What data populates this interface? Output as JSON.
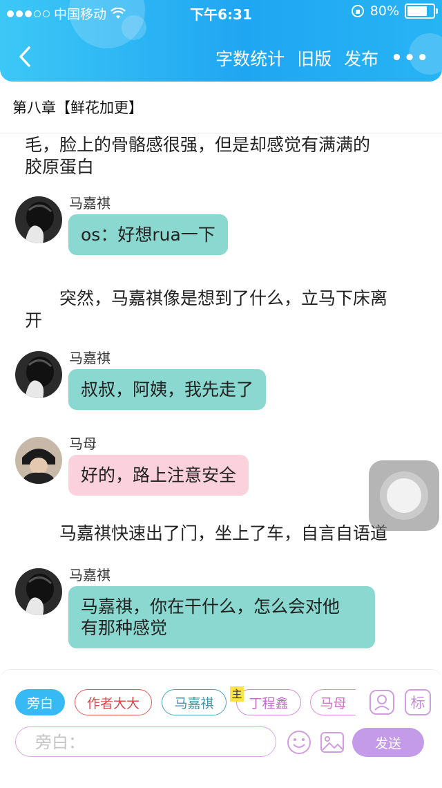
{
  "status_bar": {
    "carrier": "中国移动",
    "time": "下午6:31",
    "battery": "80%",
    "battery_level": 0.8
  },
  "nav": {
    "actions": [
      "字数统计",
      "旧版",
      "发布"
    ],
    "more_label": "•••"
  },
  "chapter": {
    "title": "第八章【鲜花加更】"
  },
  "content": [
    {
      "type": "narration",
      "lines": [
        "毛，脸上的骨骼感很强，但是却感觉有满满的",
        "胶原蛋白"
      ]
    },
    {
      "type": "message",
      "speaker": "马嘉祺",
      "lines": [
        "os：好想rua一下"
      ],
      "color": "#8ad8d0"
    },
    {
      "type": "narration",
      "lines": [
        "　　突然，马嘉祺像是想到了什么，立马下床离",
        "开"
      ]
    },
    {
      "type": "message",
      "speaker": "马嘉祺",
      "lines": [
        "叔叔，阿姨，我先走了"
      ],
      "color": "#8ad8d0"
    },
    {
      "type": "message",
      "speaker": "马母",
      "lines": [
        "好的，路上注意安全"
      ],
      "color": "#fad1dd"
    },
    {
      "type": "narration",
      "lines": [
        "　　马嘉祺快速出了门，坐上了车，自言自语道"
      ]
    },
    {
      "type": "message",
      "speaker": "马嘉祺",
      "lines": [
        "马嘉祺，你在干什么，怎么会对他",
        "有那种感觉"
      ],
      "color": "#8ad8d0"
    }
  ],
  "toolbar": {
    "roles": [
      "旁白",
      "作者大大",
      "马嘉祺",
      "丁程鑫",
      "马母"
    ],
    "main_tag": "主",
    "tag_label": "标",
    "input_placeholder": "旁白：",
    "send_label": "发送"
  },
  "colors": {
    "header": "#22aaf2",
    "teal_bubble": "#8ad8d0",
    "pink_bubble": "#fad1dd",
    "send": "#c39be9"
  }
}
